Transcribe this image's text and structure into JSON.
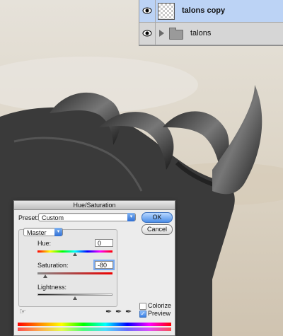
{
  "layers": [
    {
      "name": "talons copy",
      "type": "layer",
      "selected": true,
      "visible": true
    },
    {
      "name": "talons",
      "type": "group",
      "selected": false,
      "visible": true
    }
  ],
  "dialog": {
    "title": "Hue/Saturation",
    "preset_label": "Preset:",
    "preset_value": "Custom",
    "channel_value": "Master",
    "hue": {
      "label": "Hue:",
      "value": "0"
    },
    "saturation": {
      "label": "Saturation:",
      "value": "-80"
    },
    "lightness": {
      "label": "Lightness:",
      "value": "0"
    },
    "ok_label": "OK",
    "cancel_label": "Cancel",
    "colorize_label": "Colorize",
    "colorize_checked": false,
    "preview_label": "Preview",
    "preview_checked": true
  },
  "icons": {
    "eye": "eye-icon",
    "folder": "folder-icon",
    "targeted_adjustment": "hand-adjust-icon",
    "eyedropper": "eyedropper-icon",
    "eyedropper_plus": "eyedropper-plus-icon",
    "eyedropper_minus": "eyedropper-minus-icon",
    "preset_options": "preset-options-icon"
  },
  "colors": {
    "selected_layer": "#bcd3f5",
    "default_button": "#4c8ee8"
  }
}
